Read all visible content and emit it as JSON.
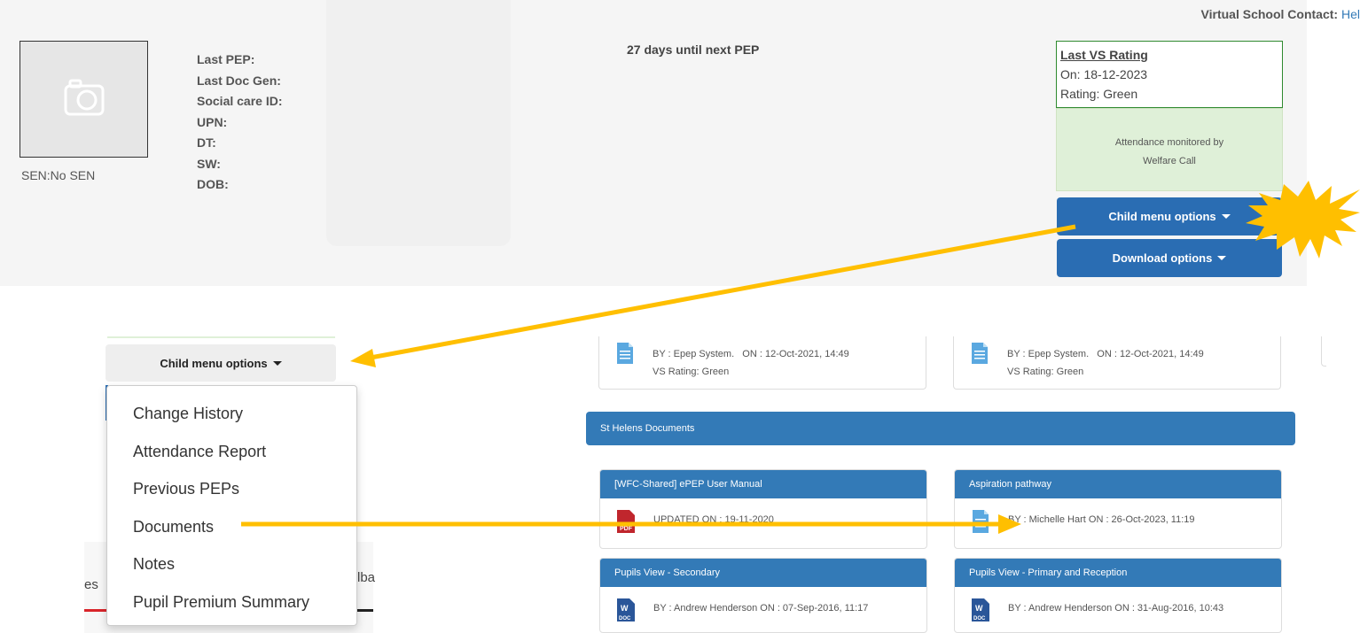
{
  "header": {
    "vs_contact_label": "Virtual School Contact:",
    "vs_contact_value": "Hel"
  },
  "profile": {
    "sen": "SEN:No SEN",
    "labels": [
      "Last PEP:",
      "Last Doc Gen:",
      "Social care ID:",
      "UPN:",
      "DT:",
      "SW:",
      "DOB:"
    ]
  },
  "next_pep": "27 days until next PEP",
  "rating": {
    "title": "Last VS Rating",
    "on": "On: 18-12-2023",
    "rating": "Rating: Green"
  },
  "attendance": {
    "line1": "Attendance monitored by",
    "line2": "Welfare Call"
  },
  "buttons": {
    "child_menu": "Child menu options",
    "download": "Download options"
  },
  "menu": {
    "items": [
      "Change History",
      "Attendance Report",
      "Previous PEPs",
      "Documents",
      "Notes",
      "Pupil Premium Summary"
    ]
  },
  "background_tabs": {
    "left_fragment": "es",
    "right_fragment": "lba"
  },
  "docs": {
    "top_cards": [
      {
        "by": "BY : Epep System.",
        "on": "ON : 12-Oct-2021, 14:49",
        "vs": "VS Rating: Green"
      },
      {
        "by": "BY : Epep System.",
        "on": "ON : 12-Oct-2021, 14:49",
        "vs": "VS Rating: Green"
      }
    ],
    "section_title": "St Helens Documents",
    "cards": [
      {
        "title": "[WFC-Shared] ePEP User Manual",
        "line": "UPDATED ON : 19-11-2020",
        "icon": "pdf-icon"
      },
      {
        "title": "Aspiration pathway",
        "line": "BY : Michelle Hart    ON : 26-Oct-2023, 11:19",
        "icon": "document-icon"
      },
      {
        "title": "Pupils View - Secondary",
        "line": "BY : Andrew Henderson    ON : 07-Sep-2016, 11:17",
        "icon": "word-icon"
      },
      {
        "title": "Pupils View - Primary and Reception",
        "line": "BY : Andrew Henderson    ON : 31-Aug-2016, 10:43",
        "icon": "word-icon"
      }
    ]
  },
  "colors": {
    "primary_blue": "#2a6db3",
    "panel_blue": "#337ab7",
    "annotation_yellow": "#ffbf00",
    "rating_border": "#2f8a2f",
    "attendance_bg": "#dff0d8"
  }
}
